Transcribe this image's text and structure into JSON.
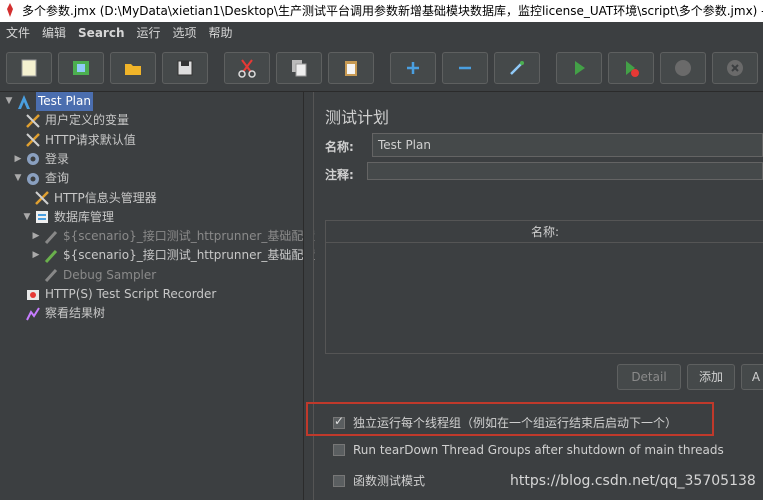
{
  "window": {
    "title": "多个参数.jmx (D:\\MyData\\xietian1\\Desktop\\生产测试平台调用参数新增基础模块数据库，监控license_UAT环境\\script\\多个参数.jmx) - A"
  },
  "menu": [
    "文件",
    "编辑",
    "Search",
    "运行",
    "选项",
    "帮助"
  ],
  "toolbar": [
    "new-icon",
    "templates-icon",
    "open-icon",
    "save-icon",
    "cut-icon",
    "copy-icon",
    "paste-icon",
    "expand-icon",
    "collapse-icon",
    "toggle-icon",
    "start-icon",
    "start-no-pause-icon",
    "stop-icon",
    "shutdown-icon"
  ],
  "tree": [
    {
      "label": "Test Plan",
      "indent": 0,
      "toggle": "▼",
      "icon": "testplan-icon",
      "selected": true
    },
    {
      "label": "用户定义的变量",
      "indent": 1,
      "toggle": "",
      "icon": "config-icon"
    },
    {
      "label": "HTTP请求默认值",
      "indent": 1,
      "toggle": "",
      "icon": "config-icon"
    },
    {
      "label": "登录",
      "indent": 1,
      "toggle": "▶",
      "icon": "threadgroup-icon"
    },
    {
      "label": "查询",
      "indent": 1,
      "toggle": "▼",
      "icon": "threadgroup-icon"
    },
    {
      "label": "HTTP信息头管理器",
      "indent": 2,
      "toggle": "",
      "icon": "config-icon"
    },
    {
      "label": "数据库管理",
      "indent": 2,
      "toggle": "▼",
      "icon": "controller-icon"
    },
    {
      "label": "${scenario}_接口测试_httprunner_基础配置",
      "indent": 3,
      "toggle": "▶",
      "icon": "sampler-disabled-icon",
      "disabled": true
    },
    {
      "label": "${scenario}_接口测试_httprunner_基础配置",
      "indent": 3,
      "toggle": "▶",
      "icon": "sampler-icon"
    },
    {
      "label": "Debug Sampler",
      "indent": 3,
      "toggle": "",
      "icon": "sampler-disabled-icon",
      "disabled": true
    },
    {
      "label": "HTTP(S) Test Script Recorder",
      "indent": 1,
      "toggle": "",
      "icon": "recorder-icon"
    },
    {
      "label": "察看结果树",
      "indent": 1,
      "toggle": "",
      "icon": "listener-icon"
    }
  ],
  "panel": {
    "title": "测试计划",
    "name_label": "名称:",
    "name_value": "Test Plan",
    "comment_label": "注释:",
    "comment_value": "",
    "table_header": "名称:",
    "buttons": {
      "detail": "Detail",
      "add": "添加",
      "more": "A"
    },
    "checkboxes": [
      {
        "label": "独立运行每个线程组（例如在一个组运行结束后启动下一个）",
        "checked": true
      },
      {
        "label": "Run tearDown Thread Groups after shutdown of main threads",
        "checked": false
      },
      {
        "label": "函数测试模式",
        "checked": false
      }
    ]
  },
  "watermark": "https://blog.csdn.net/qq_35705138"
}
